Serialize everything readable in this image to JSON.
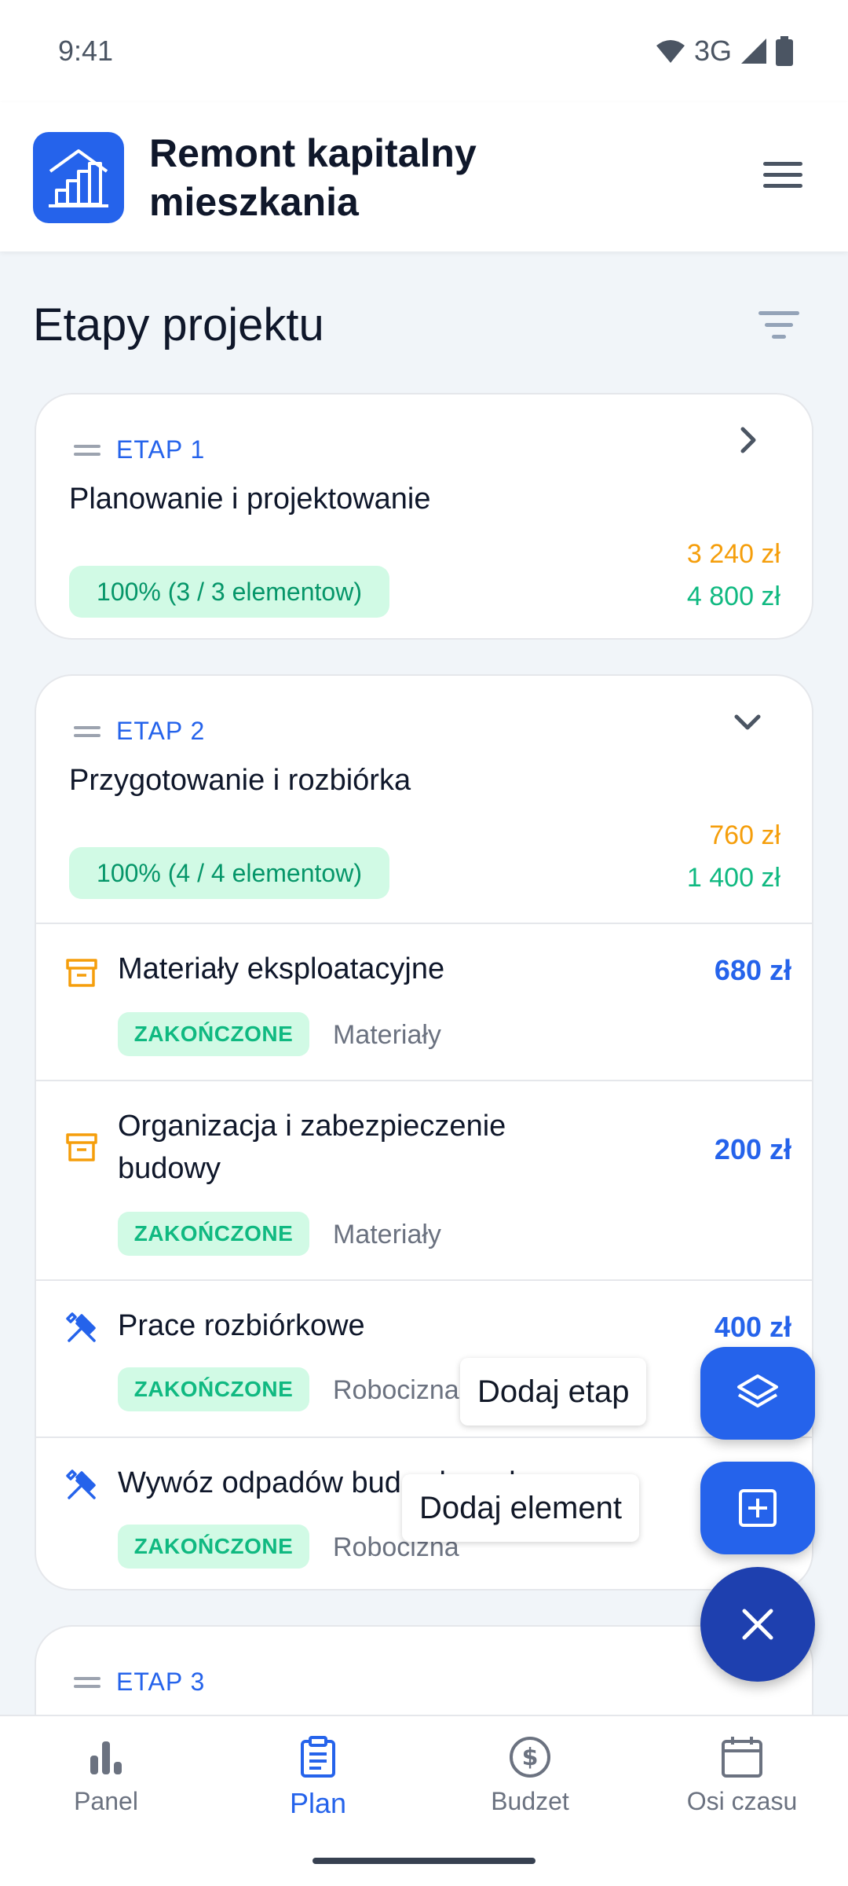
{
  "status_bar": {
    "time": "9:41",
    "network": "3G"
  },
  "app": {
    "title": "Remont kapitalny mieszkania",
    "logo_icon": "house-stairs-icon",
    "menu_icon": "hamburger-menu-icon"
  },
  "section": {
    "title": "Etapy projektu",
    "filter_icon": "filter-icon"
  },
  "stages": [
    {
      "label": "ETAP 1",
      "name": "Planowanie i projektowanie",
      "progress": "100% (3 / 3 elementow)",
      "spent": "3 240 zł",
      "budget": "4 800 zł",
      "expanded": false
    },
    {
      "label": "ETAP 2",
      "name": "Przygotowanie i rozbiórka",
      "progress": "100% (4 / 4 elementow)",
      "spent": "760 zł",
      "budget": "1 400 zł",
      "expanded": true,
      "items": [
        {
          "name": "Materiały eksploatacyjne",
          "price": "680 zł",
          "status": "ZAKOŃCZONE",
          "category": "Materiały",
          "icon": "archive-box-icon"
        },
        {
          "name": "Organizacja i zabezpieczenie budowy",
          "price": "200 zł",
          "status": "ZAKOŃCZONE",
          "category": "Materiały",
          "icon": "archive-box-icon"
        },
        {
          "name": "Prace rozbiórkowe",
          "price": "400 zł",
          "status": "ZAKOŃCZONE",
          "category": "Robocizna",
          "icon": "hammer-wrench-icon"
        },
        {
          "name": "Wywóz odpadów budowlanych",
          "price": "",
          "status": "ZAKOŃCZONE",
          "category": "Robocizna",
          "icon": "hammer-wrench-icon"
        }
      ]
    },
    {
      "label": "ETAP 3"
    }
  ],
  "fab": {
    "add_stage_label": "Dodaj etap",
    "add_element_label": "Dodaj element",
    "close_icon": "close-icon"
  },
  "bottom_nav": [
    {
      "label": "Panel",
      "icon": "bar-chart-icon",
      "active": false
    },
    {
      "label": "Plan",
      "icon": "clipboard-icon",
      "active": true
    },
    {
      "label": "Budzet",
      "icon": "dollar-circle-icon",
      "active": false
    },
    {
      "label": "Osi czasu",
      "icon": "calendar-icon",
      "active": false
    }
  ],
  "colors": {
    "primary": "#2563eb",
    "primary_dark": "#1e40af",
    "success": "#10b981",
    "warning": "#f59e0b"
  }
}
